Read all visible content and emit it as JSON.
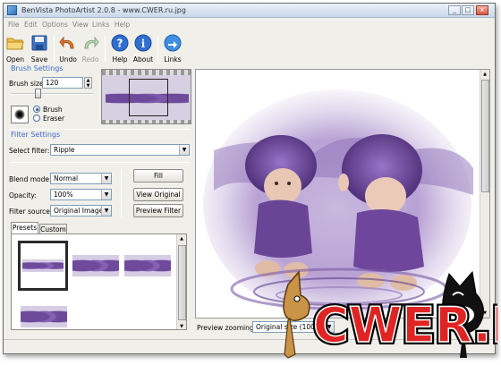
{
  "window": {
    "title": "BenVista PhotoArtist 2.0.8 - www.CWER.ru.jpg"
  },
  "menu": [
    "File",
    "Edit",
    "Options",
    "View",
    "Links",
    "Help"
  ],
  "toolbar": {
    "open": "Open",
    "save": "Save",
    "undo": "Undo",
    "redo": "Redo",
    "help": "Help",
    "about": "About",
    "links": "Links"
  },
  "brush": {
    "section_title": "Brush Settings",
    "size_label": "Brush size:",
    "size_value": "120",
    "mode_brush": "Brush",
    "mode_eraser": "Eraser"
  },
  "filter": {
    "section_title": "Filter Settings",
    "select_label": "Select filter:",
    "select_value": "Ripple",
    "blend_label": "Blend mode:",
    "blend_value": "Normal",
    "opacity_label": "Opacity:",
    "opacity_value": "100%",
    "source_label": "Filter source:",
    "source_value": "Original Image",
    "fill_button": "Fill",
    "view_original_button": "View Original",
    "preview_filter_button": "Preview Filter"
  },
  "presets": {
    "tabs": [
      "Presets",
      "Custom"
    ]
  },
  "preview": {
    "zoom_label": "Preview zooming:",
    "zoom_value": "Original size (100%)"
  },
  "watermark": {
    "text": "CWER.RU"
  },
  "colors": {
    "accent": "#3f69c8",
    "photo_purple": "#7a52a8",
    "photo_lavender": "#c7b6dc"
  }
}
